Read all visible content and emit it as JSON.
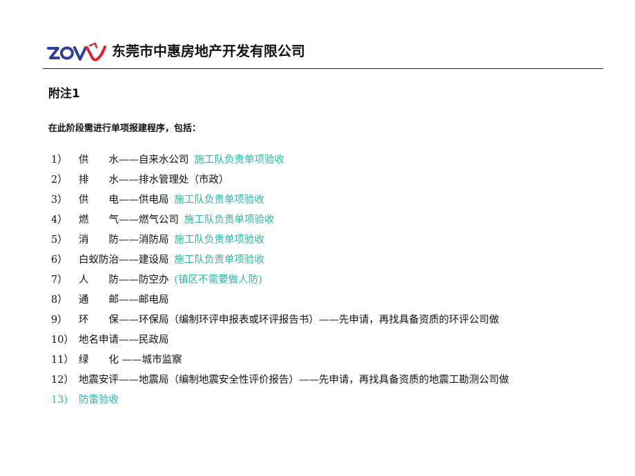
{
  "header": {
    "logo_text": "zovy",
    "company": "东莞市中惠房地产开发有限公司",
    "colors": {
      "logo_blue": "#2a3f9a",
      "logo_red": "#d9262c",
      "rule": "#222222"
    }
  },
  "title": "附注1",
  "intro": "在此阶段需进行单项报建程序，包括：",
  "accent_color": "#2bb6a0",
  "items": [
    {
      "num": "1）",
      "text": "供　　水——自来水公司",
      "note": "施工队负责单项验收"
    },
    {
      "num": "2）",
      "text": "排　　水——排水管理处（市政）",
      "note": ""
    },
    {
      "num": "3）",
      "text": "供　　电——供电局",
      "note": "施工队负责单项验收"
    },
    {
      "num": "4）",
      "text": "燃　　气——燃气公司",
      "note": "施工队负责单项验收"
    },
    {
      "num": "5）",
      "text": "消　　防——消防局",
      "note": "施工队负责单项验收"
    },
    {
      "num": "6）",
      "text": "白蚁防治——建设局",
      "note": "施工队负责单项验收"
    },
    {
      "num": "7）",
      "text": "人　　防——防空办",
      "note": "(镇区不需要做人防)"
    },
    {
      "num": "8）",
      "text": "通　　邮——邮电局",
      "note": ""
    },
    {
      "num": "9）",
      "text": "环　　保——环保局（编制环评申报表或环评报告书）——先申请，再找具备资质的环评公司做",
      "note": ""
    },
    {
      "num": "10）",
      "text": "地名申请——民政局",
      "note": ""
    },
    {
      "num": "11）",
      "text": "绿　　化 ——城市监察",
      "note": ""
    },
    {
      "num": "12）",
      "text": "地震安评——地震局（编制地震安全性评价报告）——先申请，再找具备资质的地震工勘测公司做",
      "note": ""
    },
    {
      "num": "13)",
      "text": "防雷验收",
      "note": ""
    }
  ]
}
